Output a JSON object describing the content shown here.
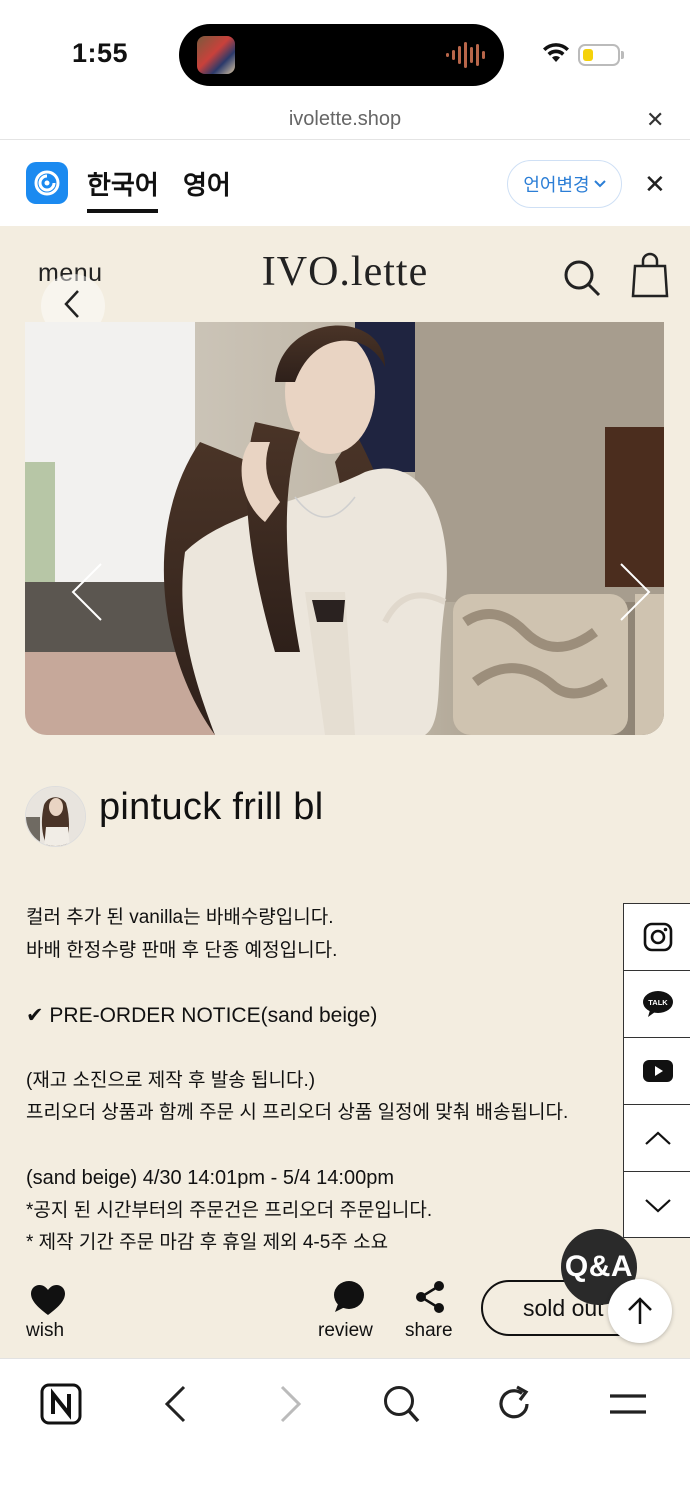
{
  "status_bar": {
    "time": "1:55"
  },
  "browser": {
    "url": "ivolette.shop",
    "close_icon": "close-icon"
  },
  "translate_bar": {
    "tab_korean": "한국어",
    "tab_english": "영어",
    "change_language": "언어변경",
    "accent": "#1b8af0"
  },
  "site": {
    "menu_label": "menu",
    "logo": "IVO.lette",
    "background": "#f3ede0"
  },
  "product": {
    "title": "pintuck frill bl",
    "description": {
      "line1": "컬러 추가 된 vanilla는 바배수량입니다.",
      "line2": "바배 한정수량 판매 후 단종 예정입니다.",
      "notice": "✔ PRE-ORDER NOTICE(sand beige)",
      "line3": "(재고 소진으로 제작 후 발송 됩니다.)",
      "line4": "프리오더 상품과 함께 주문 시 프리오더 상품 일정에 맞춰 배송됩니다.",
      "line5": "(sand beige) 4/30 14:01pm - 5/4 14:00pm",
      "line6": "*공지 된 시간부터의 주문건은 프리오더 주문입니다.",
      "line7": "* 제작 기간 주문 마감 후 휴일 제외 4-5주 소요"
    }
  },
  "side_rail": {
    "items": [
      "instagram-icon",
      "kakaotalk-icon",
      "youtube-icon",
      "scroll-up-icon",
      "scroll-down-icon"
    ],
    "talk_label": "TALK"
  },
  "action_bar": {
    "wish": "wish",
    "review": "review",
    "share": "share",
    "sold_out": "sold out",
    "qa": "Q&A"
  },
  "toolbar": {
    "items": [
      "naver-home-icon",
      "back-icon",
      "forward-icon",
      "search-icon",
      "refresh-icon",
      "menu-icon"
    ]
  }
}
